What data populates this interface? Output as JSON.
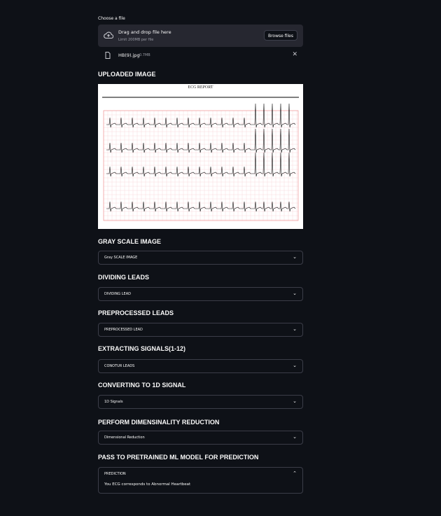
{
  "uploader": {
    "label": "Choose a file",
    "drag_text": "Drag and drop file here",
    "limit_text": "Limit 200MB per file",
    "browse_label": "Browse files",
    "file_name": "HB(9).jpg",
    "file_size": "0.7MB"
  },
  "uploaded": {
    "heading": "UPLOADED IMAGE",
    "report_title": "ECG REPORT"
  },
  "sections": [
    {
      "heading": "GRAY SCALE IMAGE",
      "expander": "Gray SCALE IMAGE"
    },
    {
      "heading": "DIVIDING LEADS",
      "expander": "DIVIDING LEAD"
    },
    {
      "heading": "PREPROCESSED LEADS",
      "expander": "PREPROCESSED LEAD"
    },
    {
      "heading": "EXTRACTING SIGNALS(1-12)",
      "expander": "CONOTUR LEADS"
    },
    {
      "heading": "CONVERTING TO 1D SIGNAL",
      "expander": "1D Signals"
    },
    {
      "heading": "PERFORM DIMENSINALITY REDUCTION",
      "expander": "Dimensional Reduction"
    }
  ],
  "prediction": {
    "heading": "PASS TO PRETRAINED ML MODEL FOR PREDICTION",
    "expander": "PREDICTION",
    "result": "You ECG corresponds to Abnormal Heartbeat",
    "expanded": true
  },
  "colors": {
    "background": "#0e1117",
    "dropzone": "#262730",
    "grid": "#f2b8c0"
  }
}
